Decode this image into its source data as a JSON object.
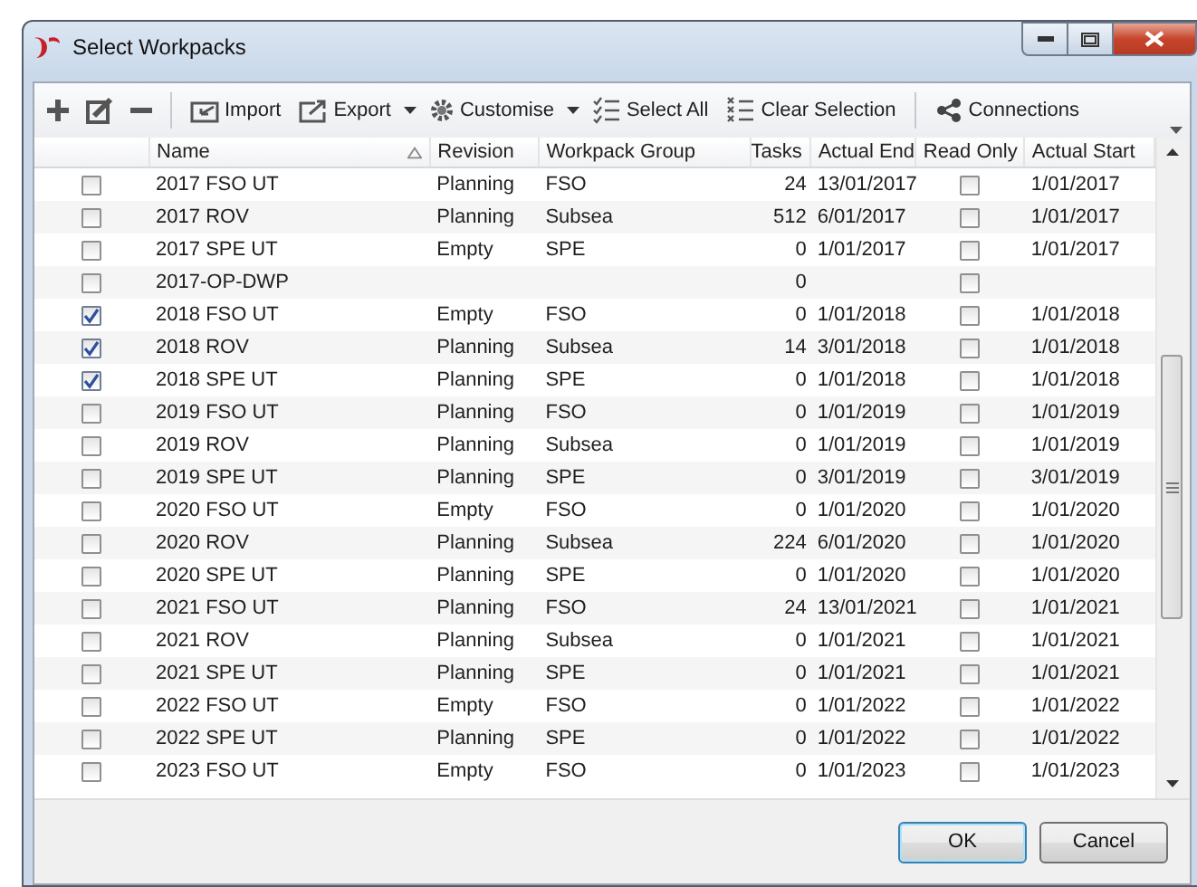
{
  "window": {
    "title": "Select Workpacks"
  },
  "toolbar": [
    {
      "kind": "icon"
    },
    {
      "kind": "icon"
    },
    {
      "kind": "icon"
    },
    {
      "kind": "separator"
    },
    {
      "kind": "button",
      "label": "Import"
    },
    {
      "kind": "button",
      "label": "Export",
      "dropdown": true
    },
    {
      "kind": "button",
      "label": "Customise",
      "dropdown": true
    },
    {
      "kind": "button",
      "label": "Select All"
    },
    {
      "kind": "button",
      "label": "Clear Selection"
    },
    {
      "kind": "separator"
    },
    {
      "kind": "button",
      "label": "Connections"
    }
  ],
  "table": {
    "columns": [
      {
        "label": "Name",
        "sorted": true
      },
      {
        "label": "Revision"
      },
      {
        "label": "Workpack Group"
      },
      {
        "label": "Tasks"
      },
      {
        "label": "Actual End"
      },
      {
        "label": "Read Only"
      },
      {
        "label": "Actual Start"
      }
    ],
    "rows": [
      {
        "selected": false,
        "name": "2017 FSO UT",
        "revision": "Planning",
        "group": "FSO",
        "tasks": "24",
        "actual_end": "13/01/2017",
        "read_only": false,
        "actual_start": "1/01/2017"
      },
      {
        "selected": false,
        "name": "2017 ROV",
        "revision": "Planning",
        "group": "Subsea",
        "tasks": "512",
        "actual_end": "6/01/2017",
        "read_only": false,
        "actual_start": "1/01/2017"
      },
      {
        "selected": false,
        "name": "2017 SPE UT",
        "revision": "Empty",
        "group": "SPE",
        "tasks": "0",
        "actual_end": "1/01/2017",
        "read_only": false,
        "actual_start": "1/01/2017"
      },
      {
        "selected": false,
        "name": "2017-OP-DWP",
        "tasks": "0",
        "read_only": false
      },
      {
        "selected": true,
        "name": "2018 FSO UT",
        "revision": "Empty",
        "group": "FSO",
        "tasks": "0",
        "actual_end": "1/01/2018",
        "read_only": false,
        "actual_start": "1/01/2018"
      },
      {
        "selected": true,
        "name": "2018 ROV",
        "revision": "Planning",
        "group": "Subsea",
        "tasks": "14",
        "actual_end": "3/01/2018",
        "read_only": false,
        "actual_start": "1/01/2018"
      },
      {
        "selected": true,
        "name": "2018 SPE UT",
        "revision": "Planning",
        "group": "SPE",
        "tasks": "0",
        "actual_end": "1/01/2018",
        "read_only": false,
        "actual_start": "1/01/2018"
      },
      {
        "selected": false,
        "name": "2019 FSO UT",
        "revision": "Planning",
        "group": "FSO",
        "tasks": "0",
        "actual_end": "1/01/2019",
        "read_only": false,
        "actual_start": "1/01/2019"
      },
      {
        "selected": false,
        "name": "2019 ROV",
        "revision": "Planning",
        "group": "Subsea",
        "tasks": "0",
        "actual_end": "1/01/2019",
        "read_only": false,
        "actual_start": "1/01/2019"
      },
      {
        "selected": false,
        "name": "2019 SPE UT",
        "revision": "Planning",
        "group": "SPE",
        "tasks": "0",
        "actual_end": "3/01/2019",
        "read_only": false,
        "actual_start": "3/01/2019"
      },
      {
        "selected": false,
        "name": "2020 FSO UT",
        "revision": "Empty",
        "group": "FSO",
        "tasks": "0",
        "actual_end": "1/01/2020",
        "read_only": false,
        "actual_start": "1/01/2020"
      },
      {
        "selected": false,
        "name": "2020 ROV",
        "revision": "Planning",
        "group": "Subsea",
        "tasks": "224",
        "actual_end": "6/01/2020",
        "read_only": false,
        "actual_start": "1/01/2020"
      },
      {
        "selected": false,
        "name": "2020 SPE UT",
        "revision": "Planning",
        "group": "SPE",
        "tasks": "0",
        "actual_end": "1/01/2020",
        "read_only": false,
        "actual_start": "1/01/2020"
      },
      {
        "selected": false,
        "name": "2021 FSO UT",
        "revision": "Planning",
        "group": "FSO",
        "tasks": "24",
        "actual_end": "13/01/2021",
        "read_only": false,
        "actual_start": "1/01/2021"
      },
      {
        "selected": false,
        "name": "2021 ROV",
        "revision": "Planning",
        "group": "Subsea",
        "tasks": "0",
        "actual_end": "1/01/2021",
        "read_only": false,
        "actual_start": "1/01/2021"
      },
      {
        "selected": false,
        "name": "2021 SPE UT",
        "revision": "Planning",
        "group": "SPE",
        "tasks": "0",
        "actual_end": "1/01/2021",
        "read_only": false,
        "actual_start": "1/01/2021"
      },
      {
        "selected": false,
        "name": "2022 FSO UT",
        "revision": "Empty",
        "group": "FSO",
        "tasks": "0",
        "actual_end": "1/01/2022",
        "read_only": false,
        "actual_start": "1/01/2022"
      },
      {
        "selected": false,
        "name": "2022 SPE UT",
        "revision": "Planning",
        "group": "SPE",
        "tasks": "0",
        "actual_end": "1/01/2022",
        "read_only": false,
        "actual_start": "1/01/2022"
      },
      {
        "selected": false,
        "name": "2023 FSO UT",
        "revision": "Empty",
        "group": "FSO",
        "tasks": "0",
        "actual_end": "1/01/2023",
        "read_only": false,
        "actual_start": "1/01/2023"
      }
    ]
  },
  "buttons": [
    {
      "label": "OK",
      "default": true
    },
    {
      "label": "Cancel",
      "default": false
    }
  ]
}
